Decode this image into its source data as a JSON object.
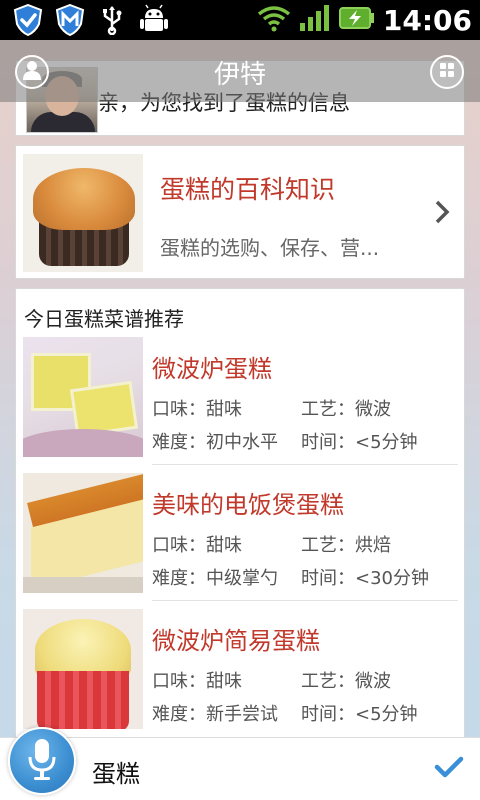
{
  "status_bar": {
    "time": "14:06",
    "left_icons": [
      "shield-icon",
      "m-shield-icon",
      "usb-icon",
      "android-icon"
    ],
    "right_icons": [
      "wifi-icon",
      "signal-icon",
      "battery-charging-icon"
    ]
  },
  "header": {
    "title": "伊特",
    "left_icon": "profile-icon",
    "right_icon": "grid-menu-icon"
  },
  "message": {
    "text": "亲，为您找到了蛋糕的信息"
  },
  "wiki": {
    "title": "蛋糕的百科知识",
    "subtitle": "蛋糕的选购、保存、营..."
  },
  "recipes": {
    "section_title": "今日蛋糕菜谱推荐",
    "items": [
      {
        "name": "微波炉蛋糕",
        "taste": "口味：甜味",
        "technique": "工艺：微波",
        "difficulty": "难度：初中水平",
        "time": "时间：<5分钟"
      },
      {
        "name": "美味的电饭煲蛋糕",
        "taste": "口味：甜味",
        "technique": "工艺：烘焙",
        "difficulty": "难度：中级掌勺",
        "time": "时间：<30分钟"
      },
      {
        "name": "微波炉简易蛋糕",
        "taste": "口味：甜味",
        "technique": "工艺：微波",
        "difficulty": "难度：新手尝试",
        "time": "时间：<5分钟"
      }
    ]
  },
  "bottom_bar": {
    "query": "蛋糕",
    "mic_icon": "microphone-icon",
    "confirm_icon": "checkmark-icon"
  },
  "colors": {
    "accent_red": "#c0392b",
    "mic_blue": "#3b8ed0",
    "check_blue": "#3a8fd9"
  }
}
